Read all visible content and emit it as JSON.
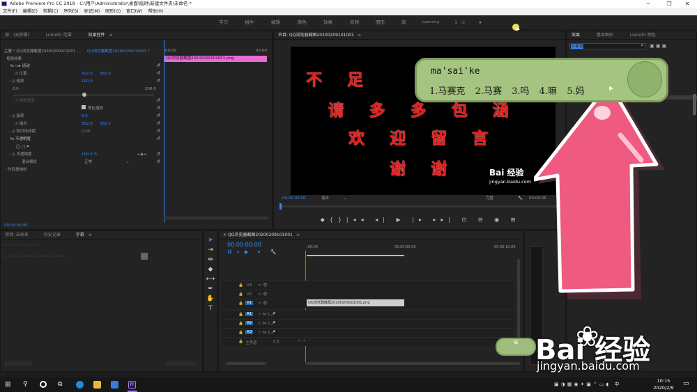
{
  "window": {
    "title": "Adobe Premiere Pro CC 2018 - C:\\用户\\Administrator\\桌面\\临时\\新建文件夹\\未命名 *",
    "minimize": "─",
    "maximize": "❐",
    "close": "✕"
  },
  "menu": [
    "文件(F)",
    "编辑(E)",
    "剪辑(C)",
    "序列(S)",
    "标记(M)",
    "图形(G)",
    "窗口(W)",
    "帮助(H)"
  ],
  "workspaces": [
    "学习",
    "组件",
    "编辑",
    "颜色",
    "效果",
    "音频",
    "图形",
    "库",
    "Learning",
    "1",
    "≡",
    "»"
  ],
  "source_panel": {
    "tabs": [
      "源：(无剪辑)",
      "Lumetri 范围",
      "效果控件"
    ],
    "active_tab": "效果控件",
    "master": "主要 * QQ浏览器截图20200209101001 ...",
    "seq": "QQ浏览器截图20200209101001 * ...",
    "time_start": "00:00",
    "time_end": "00:00",
    "clip": "QQ浏览器截图20200209101001.png",
    "video_effects": "视频效果",
    "motion": "运动",
    "position": "位置",
    "pos_x": "502.0",
    "pos_y": "282.5",
    "scale": "缩放",
    "scale_val": "100.0",
    "scale_width": "缩放宽度",
    "range_min": "0.0",
    "range_max": "200.0",
    "uniform_scale": "等比缩放",
    "rotation": "旋转",
    "rotation_val": "0.0",
    "anchor": "锚点",
    "anchor_x": "502.0",
    "anchor_y": "282.5",
    "anti_flicker": "防闪烁滤镜",
    "anti_flicker_val": "0.00",
    "opacity_group": "不透明度",
    "opacity": "不透明度",
    "opacity_val": "100.0 %",
    "blend_mode": "混合模式",
    "blend_val": "正常",
    "time_remap": "时间重映射",
    "timecode": "00:00:00:00"
  },
  "program": {
    "title": "节目: QQ浏览器截图20200209101001",
    "timecode": "00:00:00:00",
    "fit": "适合",
    "quality": "完整",
    "duration": "00:00:05",
    "lines": [
      "不 足",
      "请 多 多 包 涵",
      "欢 迎 留 言",
      "谢 谢"
    ],
    "watermark1": "Bai 经验",
    "watermark2": "jingyan.baidu.com"
  },
  "effects_panel": {
    "tabs": [
      "效果",
      "基本图形",
      "Lumetri 颜色"
    ],
    "search_value": "字幕调"
  },
  "project_panel": {
    "tabs": [
      "项目: 未命名",
      "历史记录",
      "字幕"
    ],
    "active_tab": "字幕"
  },
  "timeline": {
    "tab": "QQ浏览器截图20200209101001",
    "timecode": "00:00:00:00",
    "ruler": [
      ":00:00",
      "00:00:05:00",
      "00:00:10:00"
    ],
    "tracks_video": [
      "V3",
      "V2",
      "V1"
    ],
    "tracks_audio": [
      "A1",
      "A2",
      "A3"
    ],
    "master": "主声道",
    "master_val": "0.0",
    "clip": "QQ浏览器截图20200209101001.png"
  },
  "ime": {
    "input": "ma'sai'ke",
    "candidates": [
      "1.马赛克",
      "2.马赛",
      "3.吗",
      "4.嘛",
      "5.妈"
    ]
  },
  "taskbar": {
    "time": "10:15",
    "date": "2020/2/9"
  },
  "overlay": {
    "baidu": "Bai 经验",
    "baidu_url": "jingyan.baidu.com",
    "badge": "猫"
  },
  "colors": {
    "accent": "#2f8bff",
    "arrow": "#ef5a80",
    "ime_bg": "#a5c381",
    "clip": "#e76bd3"
  }
}
